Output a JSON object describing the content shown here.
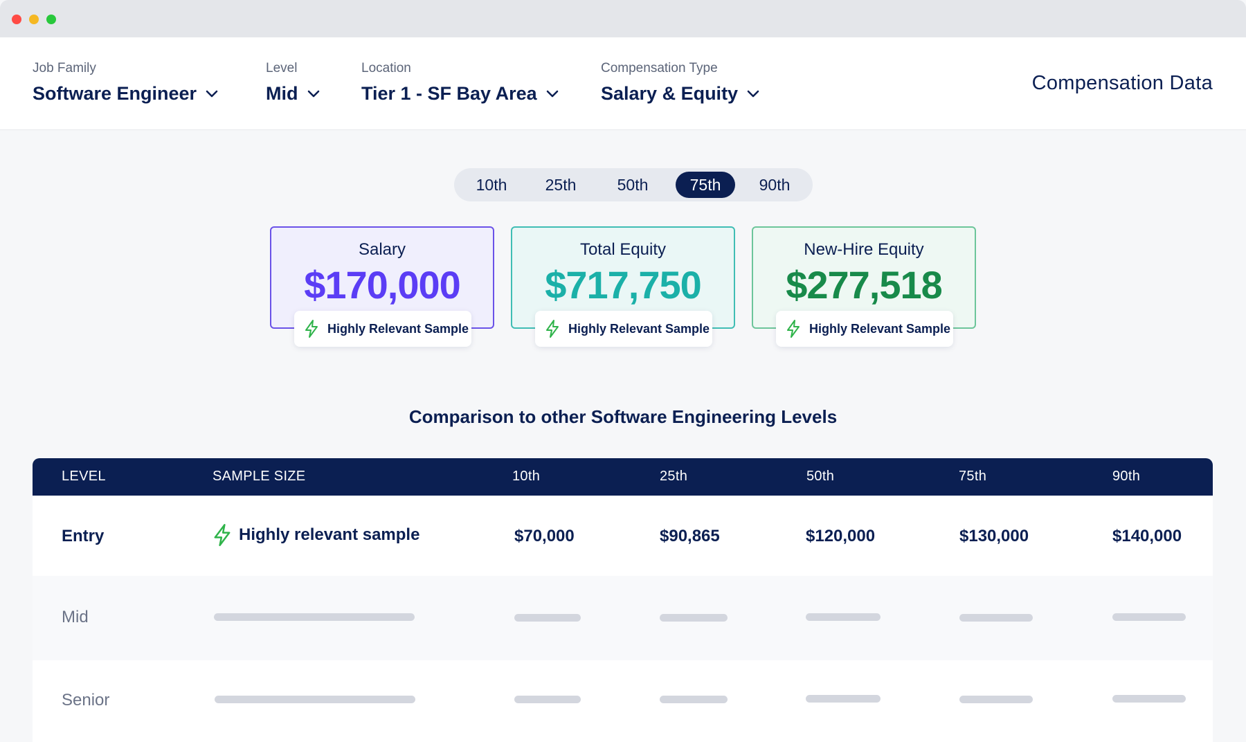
{
  "filters": [
    {
      "label": "Job Family",
      "value": "Software Engineer"
    },
    {
      "label": "Level",
      "value": "Mid"
    },
    {
      "label": "Location",
      "value": "Tier 1 - SF Bay Area"
    },
    {
      "label": "Compensation Type",
      "value": "Salary & Equity"
    }
  ],
  "header_title": "Compensation Data",
  "percentiles": {
    "options": [
      "10th",
      "25th",
      "50th",
      "75th",
      "90th"
    ],
    "selected": "75th"
  },
  "cards": [
    {
      "title": "Salary",
      "value": "$170,000",
      "badge": "Highly Relevant Sample",
      "color": "#5b3df5",
      "bg": "#f0effd",
      "border": "#6a52e8"
    },
    {
      "title": "Total Equity",
      "value": "$717,750",
      "badge": "Highly Relevant Sample",
      "color": "#1bb0a8",
      "bg": "#eaf7f6",
      "border": "#3fbdb4"
    },
    {
      "title": "New-Hire Equity",
      "value": "$277,518",
      "badge": "Highly Relevant Sample",
      "color": "#188a4a",
      "bg": "#eef8f3",
      "border": "#6cc59a"
    }
  ],
  "section_title": "Comparison to other Software Engineering Levels",
  "table": {
    "headers": [
      "LEVEL",
      "SAMPLE SIZE",
      "10th",
      "25th",
      "50th",
      "75th",
      "90th"
    ],
    "rows": [
      {
        "level": "Entry",
        "sample": "Highly relevant sample",
        "values": [
          "$70,000",
          "$90,865",
          "$120,000",
          "$130,000",
          "$140,000"
        ]
      },
      {
        "level": "Mid"
      },
      {
        "level": "Senior"
      }
    ]
  },
  "colors": {
    "navy": "#0b1f52",
    "bolt": "#2fb34a",
    "placeholder": "#d3d6de"
  },
  "icons": {
    "dropdown": "chevron-down-icon",
    "sample": "lightning-bolt-icon"
  }
}
